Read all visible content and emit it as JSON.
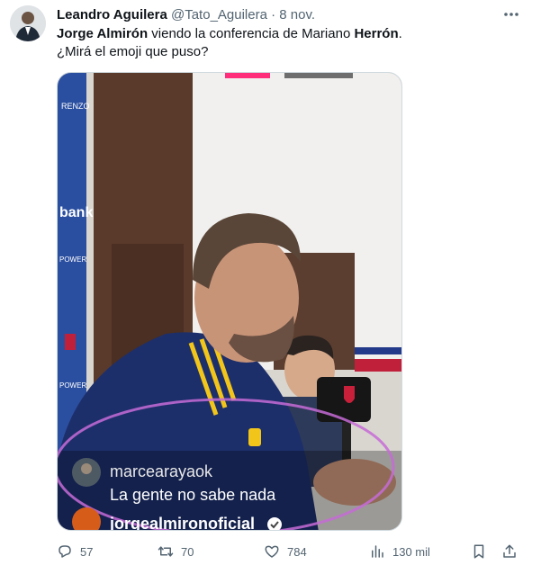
{
  "tweet": {
    "author": {
      "display_name": "Leandro Aguilera",
      "handle": "@Tato_Aguilera",
      "separator": "·",
      "date": "8 nov."
    },
    "text": {
      "line1_name1": "Jorge Almirón",
      "line1_mid": " viendo la conferencia de Mariano ",
      "line1_name2": "Herrón",
      "line1_end": ".",
      "line2": "¿Mirá el emoji que puso?"
    },
    "media": {
      "comment_user": "marcearayaok",
      "comment_text": "La gente no sabe nada",
      "next_user": "jorgealmirono​ficial"
    },
    "actions": {
      "replies": "57",
      "retweets": "70",
      "likes": "784",
      "views": "130 mil"
    }
  },
  "icons": [
    "more-icon",
    "reply-icon",
    "retweet-icon",
    "like-icon",
    "views-icon",
    "bookmark-icon",
    "share-icon"
  ],
  "colors": {
    "text": "#0f1419",
    "secondary": "#536471",
    "border": "#cfd9de"
  }
}
